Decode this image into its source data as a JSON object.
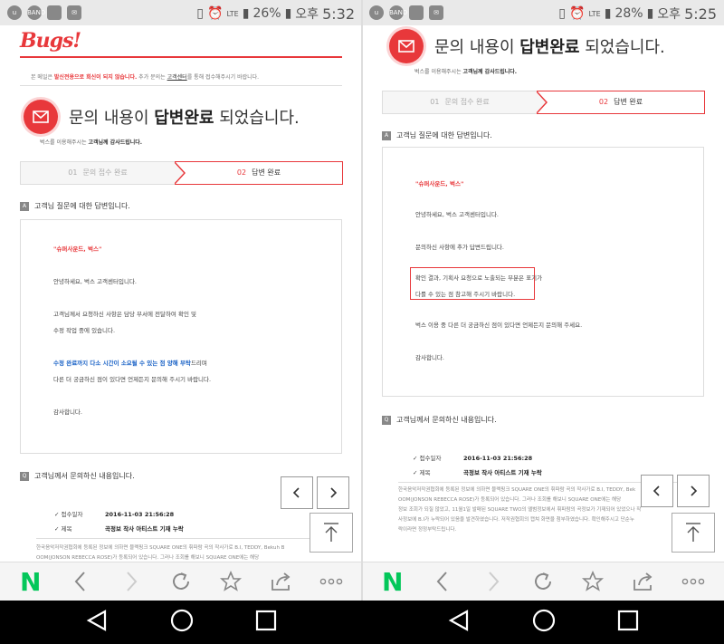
{
  "statusbar_left": {
    "battery": "26%",
    "ampm": "오후",
    "time": "5:32",
    "network": "LTE"
  },
  "statusbar_right": {
    "battery": "28%",
    "ampm": "오후",
    "time": "5:25",
    "network": "LTE"
  },
  "app": {
    "logo": "Bugs!",
    "notice_prefix": "본 메일은 ",
    "notice_red": "발신전용으로 회신이 되지 않습니다.",
    "notice_mid": " 추가 문의는 ",
    "notice_link": "고객센터",
    "notice_suffix": "를 통해 접수해주시기 바랍니다."
  },
  "hero": {
    "title_prefix": "문의 내용이 ",
    "title_bold": "답변완료",
    "title_suffix": " 되었습니다.",
    "thanks_prefix": "벅스를 이용해주시는 ",
    "thanks_bold": "고객님께 감사드립니다."
  },
  "steps": {
    "step1_num": "01",
    "step1_label": "문의 접수 완료",
    "step2_num": "02",
    "step2_label": "답변 완료"
  },
  "answer_section": {
    "badge": "A",
    "title": "고객님 질문에 대한 답변입니다."
  },
  "answer_left": {
    "greeting_red": "\"슈퍼사운드, 벅스\"",
    "hello": "안녕하세요, 벅스 고객센터입니다.",
    "line1": "고객님께서 요청하신 사항은 담당 부서에 전달하여 확인 및",
    "line2": "수정 작업 중에 있습니다.",
    "blue_part": "수정 완료까지 다소 시간이 소요될 수 있는 점 양해 부탁",
    "after_blue": "드리며",
    "line4": "다른 더 궁금하신 점이 있다면 언제든지 문의해 주시기 바랍니다.",
    "closing": "감사합니다."
  },
  "answer_right": {
    "greeting_red": "\"슈퍼사운드, 벅스\"",
    "hello": "안녕하세요, 벅스 고객센터입니다.",
    "line1": "문의하신 사항에 추가 답변드립니다.",
    "highlight1": "확인 결과, 기획사 요청으로 노출되는 부분은 표기가",
    "highlight2": "다를 수 있는 점 참고해 주시기 바랍니다.",
    "line4": "벅스 이용 중 다른 더 궁금하신 점이 있다면 언제든지 문의해 주세요.",
    "closing": "감사합니다."
  },
  "question_section": {
    "badge": "Q",
    "title": "고객님께서 문의하신 내용입니다.",
    "date_label": "접수일자",
    "date_value": "2016-11-03 21:56:28",
    "subject_label": "제목",
    "subject_value": "곡정보 작사 아티스트 기재 누락"
  },
  "question_body_left": [
    "한국음악저작권협회에 등록된 정보에 의하면 블랙핑크 SQUARE ONE의 휘파람 곡의 작사가로 B.I, TEDDY, Bekuh B",
    "OOM(JONSON REBECCA ROSE)가 등록되어 있습니다. 그러나 조회를 해보니 SQUARE ONE에는 해당"
  ],
  "question_body_right": [
    "한국음악저작권협회에 등록된 정보에 의하면 블랙핑크 SQUARE ONE의 휘파람 곡의 작사가로 B.I, TEDDY, Bek",
    "OOM(JONSON REBECCA ROSE)가 등록되어 있습니다. 그러나 조회를 해보니 SQUARE ONE에는 해당",
    "정보 조회가 되질 않았고, 11월1일 발매된 SQUARE TWO의 앨범정보에서 휘파람의 곡정보가 기재되어 있었으나 작",
    "사정보에 B.I가 누락되어 있음을 발견하였습니다. 저작권협회의 캡쳐 화면을 첨부하였습니다. 확인해주시고 단순누",
    "락이라면 정정부탁드립니다."
  ],
  "colors": {
    "accent": "#e8383b",
    "blue": "#1a62c6",
    "naver": "#03c75a"
  }
}
